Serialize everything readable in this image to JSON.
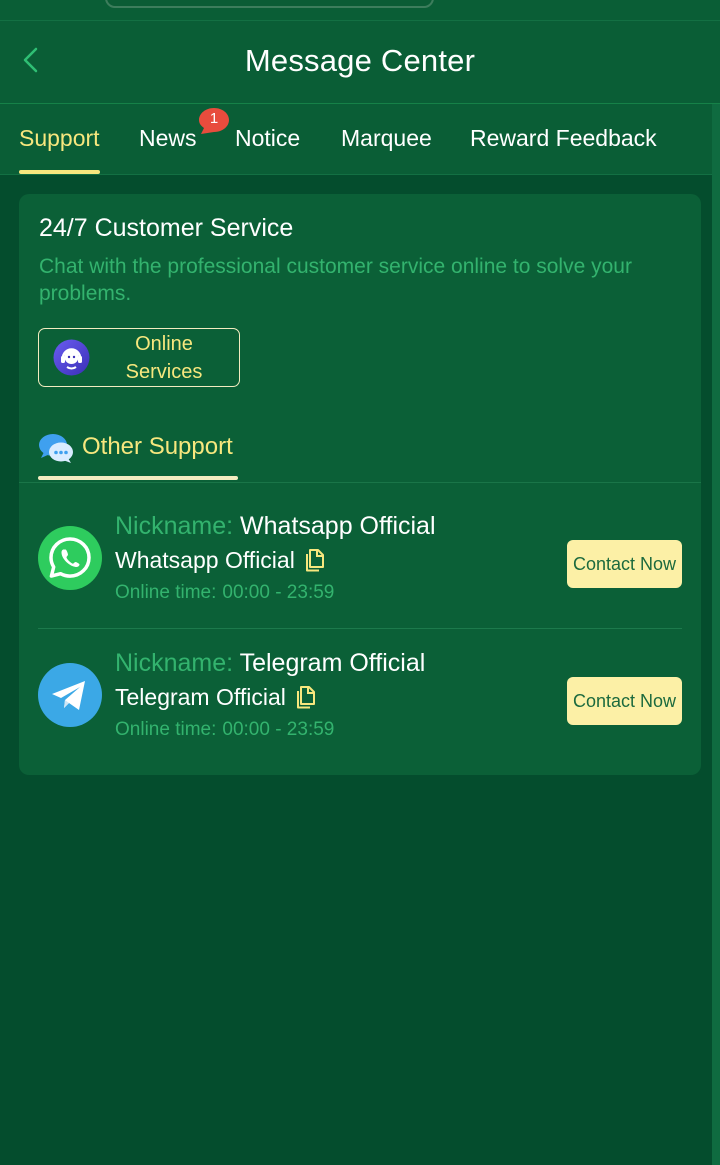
{
  "header": {
    "title": "Message Center"
  },
  "tabs": [
    {
      "label": "Support",
      "active": true
    },
    {
      "label": "News",
      "badge": "1"
    },
    {
      "label": "Notice"
    },
    {
      "label": "Marquee"
    },
    {
      "label": "Reward Feedback"
    }
  ],
  "customer_service": {
    "title": "24/7 Customer Service",
    "description": "Chat with the professional customer service online to solve your problems.",
    "button_label": "Online Services"
  },
  "other_support": {
    "label": "Other Support"
  },
  "contacts": [
    {
      "nickname_label": "Nickname:",
      "nickname": "Whatsapp Official",
      "account": "Whatsapp Official",
      "online_label": "Online time:",
      "online_time": "00:00 - 23:59",
      "button_label": "Contact Now",
      "icon": "whatsapp-icon"
    },
    {
      "nickname_label": "Nickname:",
      "nickname": "Telegram Official",
      "account": "Telegram Official",
      "online_label": "Online time:",
      "online_time": "00:00 - 23:59",
      "button_label": "Contact Now",
      "icon": "telegram-icon"
    }
  ],
  "colors": {
    "background": "#044d2d",
    "card": "#0b6037",
    "accent": "#f7e77e",
    "muted_green": "#33b36e",
    "button": "#fcf0a6",
    "badge": "#e84c3d"
  }
}
